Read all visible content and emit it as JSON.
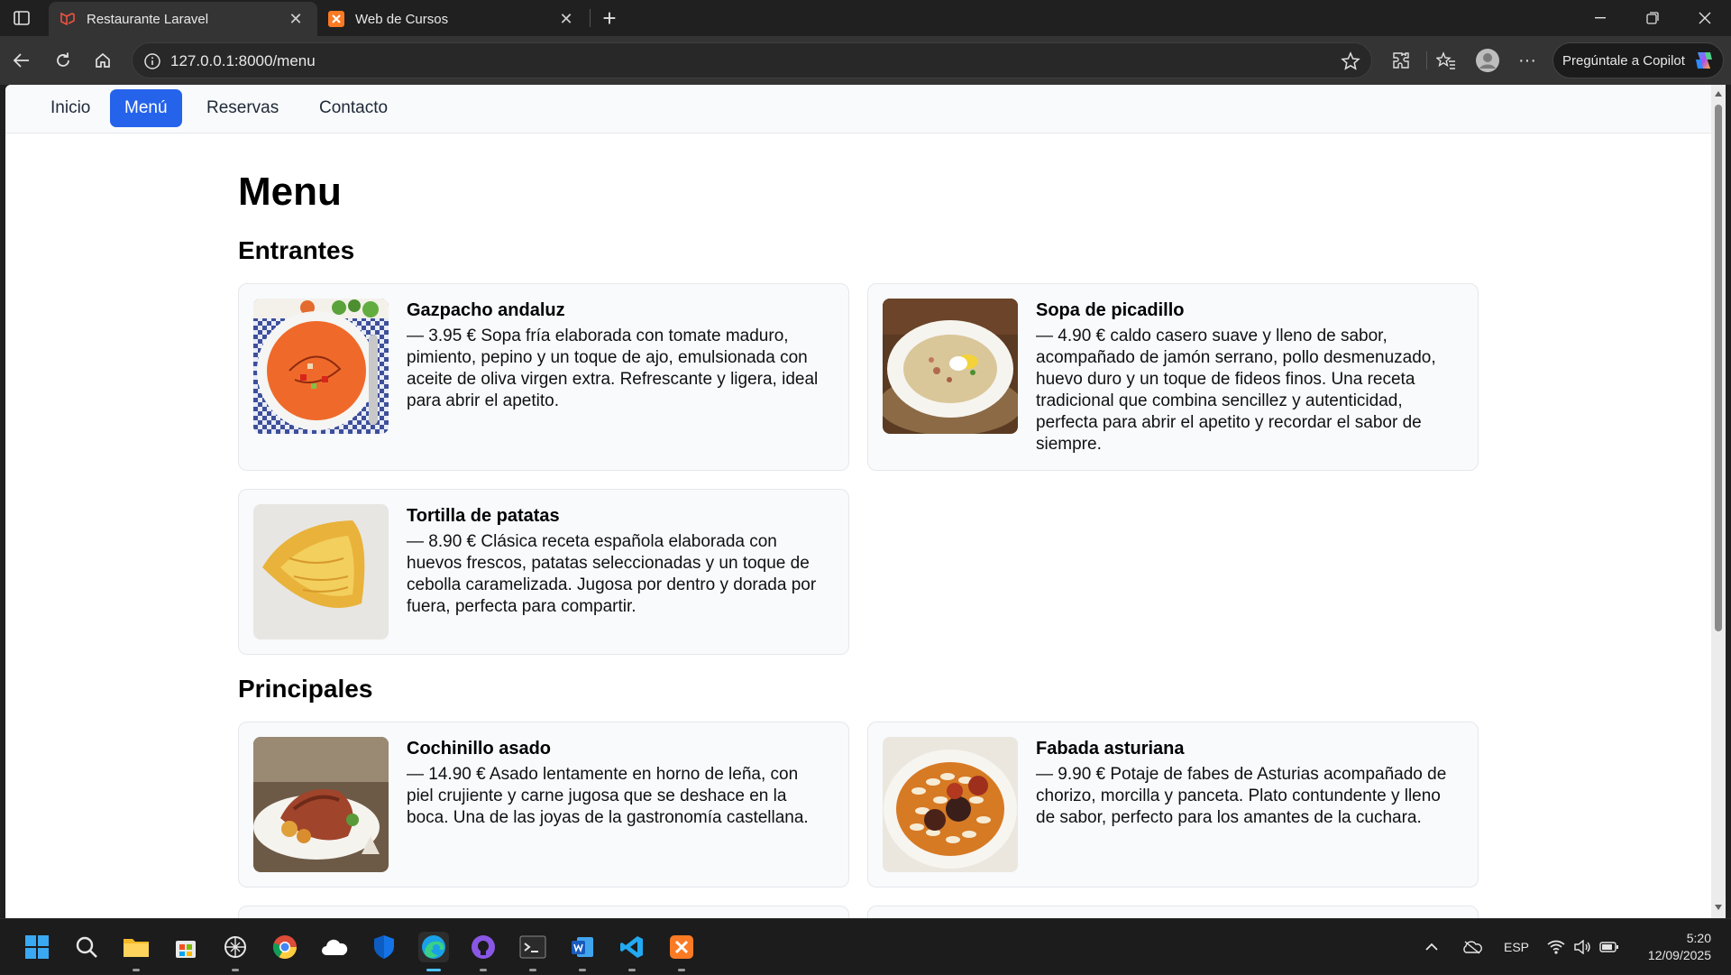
{
  "browser": {
    "tabs": [
      {
        "title": "Restaurante Laravel",
        "active": true,
        "favicon_color": "#f05340"
      },
      {
        "title": "Web de Cursos",
        "active": false,
        "favicon_color": "#fb7a24"
      }
    ],
    "new_tab_label": "+",
    "url": "127.0.0.1:8000/menu",
    "copilot_label": "Pregúntale a Copilot"
  },
  "navbar": {
    "links": [
      {
        "label": "Inicio",
        "active": false
      },
      {
        "label": "Menú",
        "active": true
      },
      {
        "label": "Reservas",
        "active": false
      },
      {
        "label": "Contacto",
        "active": false
      }
    ],
    "accent_color": "#2563eb"
  },
  "page": {
    "title": "Menu",
    "sections": [
      {
        "heading": "Entrantes",
        "items": [
          {
            "name": "Gazpacho andaluz",
            "description": "— 3.95 € Sopa fría elaborada con tomate maduro, pimiento, pepino y un toque de ajo, emulsionada con aceite de oliva virgen extra. Refrescante y ligera, ideal para abrir el apetito.",
            "image": "gazpacho"
          },
          {
            "name": "Sopa de picadillo",
            "description": "— 4.90 € caldo casero suave y lleno de sabor, acompañado de jamón serrano, pollo desmenuzado, huevo duro y un toque de fideos finos. Una receta tradicional que combina sencillez y autenticidad, perfecta para abrir el apetito y recordar el sabor de siempre.",
            "image": "sopa"
          },
          {
            "name": "Tortilla de patatas",
            "description": "— 8.90 € Clásica receta española elaborada con huevos frescos, patatas seleccionadas y un toque de cebolla caramelizada. Jugosa por dentro y dorada por fuera, perfecta para compartir.",
            "image": "tortilla"
          }
        ]
      },
      {
        "heading": "Principales",
        "items": [
          {
            "name": "Cochinillo asado",
            "description": "— 14.90 € Asado lentamente en horno de leña, con piel crujiente y carne jugosa que se deshace en la boca. Una de las joyas de la gastronomía castellana.",
            "image": "cochinillo"
          },
          {
            "name": "Fabada asturiana",
            "description": "— 9.90 € Potaje de fabes de Asturias acompañado de chorizo, morcilla y panceta. Plato contundente y lleno de sabor, perfecto para los amantes de la cuchara.",
            "image": "fabada"
          }
        ]
      }
    ]
  },
  "taskbar": {
    "apps": [
      "start-icon",
      "search-icon",
      "file-explorer-icon",
      "store-icon",
      "chatgpt-icon",
      "chrome-icon",
      "onedrive-icon",
      "defender-icon",
      "edge-icon",
      "github-icon",
      "terminal-icon",
      "word-icon",
      "vscode-icon",
      "xampp-icon"
    ],
    "language": "ESP",
    "time": "5:20",
    "date": "12/09/2025"
  }
}
